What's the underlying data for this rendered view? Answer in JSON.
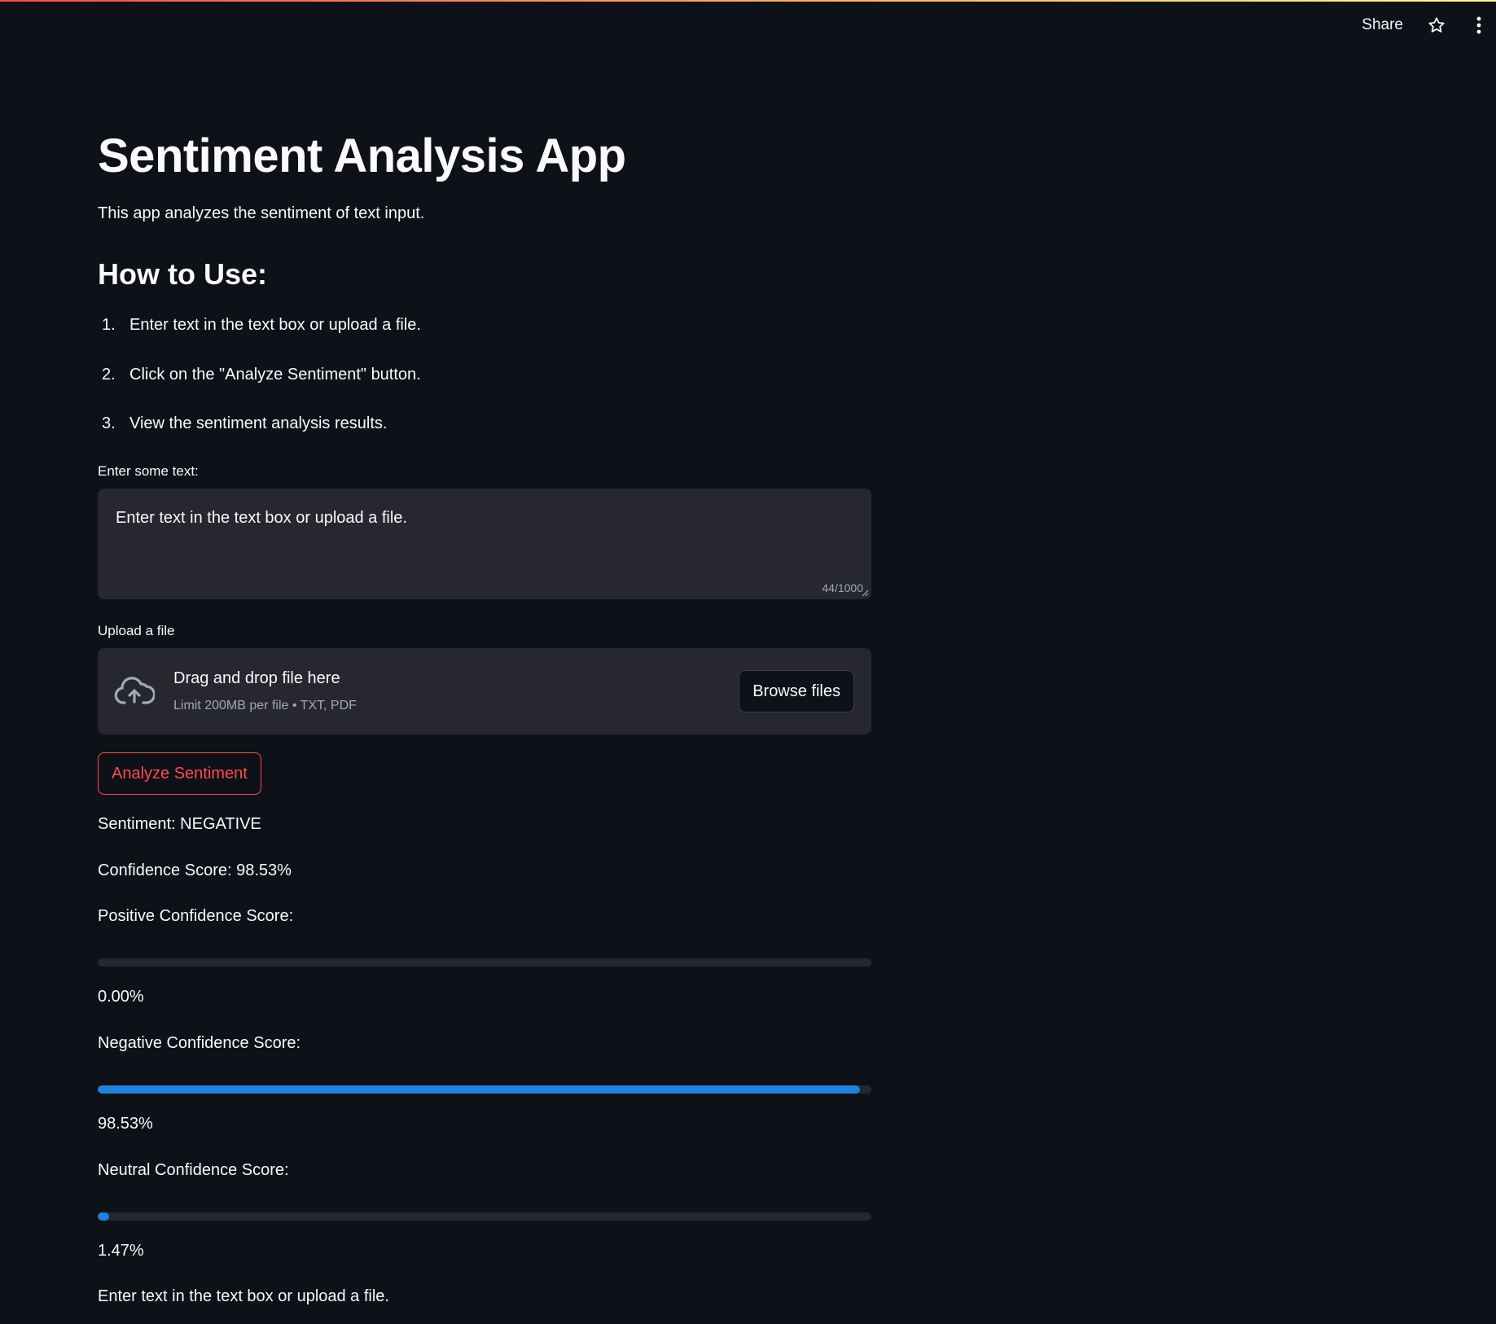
{
  "header": {
    "share_label": "Share",
    "star_icon": "star-icon",
    "menu_icon": "vertical-dots-icon"
  },
  "main": {
    "title": "Sentiment Analysis App",
    "intro": "This app analyzes the sentiment of text input.",
    "how_to_heading": "How to Use:",
    "steps": [
      {
        "num": "1.",
        "text": "Enter text in the text box or upload a file."
      },
      {
        "num": "2.",
        "text": "Click on the \"Analyze Sentiment\" button."
      },
      {
        "num": "3.",
        "text": "View the sentiment analysis results."
      }
    ]
  },
  "text_input": {
    "label": "Enter some text:",
    "value": "Enter text in the text box or upload a file.",
    "char_count": "44/1000"
  },
  "file_upload": {
    "label": "Upload a file",
    "drop_text": "Drag and drop file here",
    "limit_text": "Limit 200MB per file • TXT, PDF",
    "browse_label": "Browse files",
    "icon": "cloud-upload-icon"
  },
  "analyze_button": "Analyze Sentiment",
  "results": {
    "sentiment": "Sentiment: NEGATIVE",
    "confidence": "Confidence Score: 98.53%",
    "positive_label": "Positive Confidence Score:",
    "positive_value": "0.00%",
    "positive_fraction": 0.0,
    "negative_label": "Negative Confidence Score:",
    "negative_value": "98.53%",
    "negative_fraction": 0.9853,
    "neutral_label": "Neutral Confidence Score:",
    "neutral_value": "1.47%",
    "neutral_fraction": 0.0147,
    "footer_text": "Enter text in the text box or upload a file."
  },
  "colors": {
    "background": "#0e1117",
    "surface": "#262730",
    "text": "#fafafa",
    "muted": "#a3a8b8",
    "primary": "#ff4b4b",
    "progress": "#1c83e1"
  }
}
